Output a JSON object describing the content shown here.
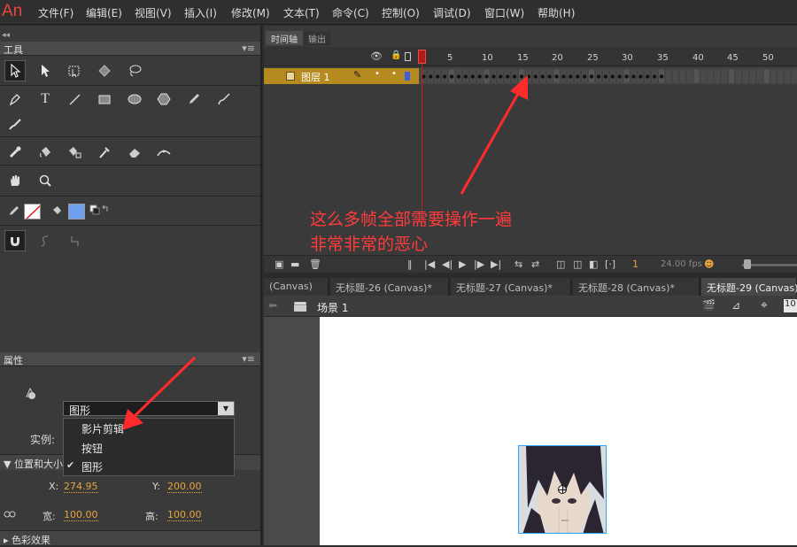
{
  "app": {
    "logo": "An"
  },
  "menu": [
    "文件(F)",
    "编辑(E)",
    "视图(V)",
    "插入(I)",
    "修改(M)",
    "文本(T)",
    "命令(C)",
    "控制(O)",
    "调试(D)",
    "窗口(W)",
    "帮助(H)"
  ],
  "tools_panel": {
    "title": "工具",
    "menu_glyph": "▾≡",
    "collapse_glyph": "◂◂"
  },
  "properties_panel": {
    "title": "属性",
    "symbol_type": "图形",
    "instance_label": "实例:",
    "section_position": "位置和大小",
    "section_color": "色彩效果",
    "x_label": "X:",
    "x_value": "274.95",
    "y_label": "Y:",
    "y_value": "200.00",
    "w_label": "宽:",
    "w_value": "100.00",
    "h_label": "高:",
    "h_value": "100.00",
    "dropdown_options": [
      {
        "label": "影片剪辑",
        "checked": false
      },
      {
        "label": "按钮",
        "checked": false
      },
      {
        "label": "图形",
        "checked": true
      }
    ],
    "check_glyph": "✔"
  },
  "timeline": {
    "tabs": [
      "时间轴",
      "输出"
    ],
    "layer_name": "图层 1",
    "ruler": [
      "1",
      "5",
      "10",
      "15",
      "20",
      "25",
      "30",
      "35",
      "40",
      "45",
      "50"
    ],
    "current_frame": "1",
    "fps": "24.00 fps",
    "annotation_line1": "这么多帧全部需要操作一遍",
    "annotation_line2": "非常非常的恶心"
  },
  "doc_tabs": [
    "(Canvas)",
    "无标题-26 (Canvas)*",
    "无标题-27 (Canvas)*",
    "无标题-28 (Canvas)*",
    "无标题-29 (Canvas)"
  ],
  "scene": {
    "label": "场景 1",
    "zoom": "10"
  },
  "colors": {
    "accent_red": "#ff3b3b",
    "layer_gold": "#b58a1e",
    "value_orange": "#e6a43a"
  }
}
